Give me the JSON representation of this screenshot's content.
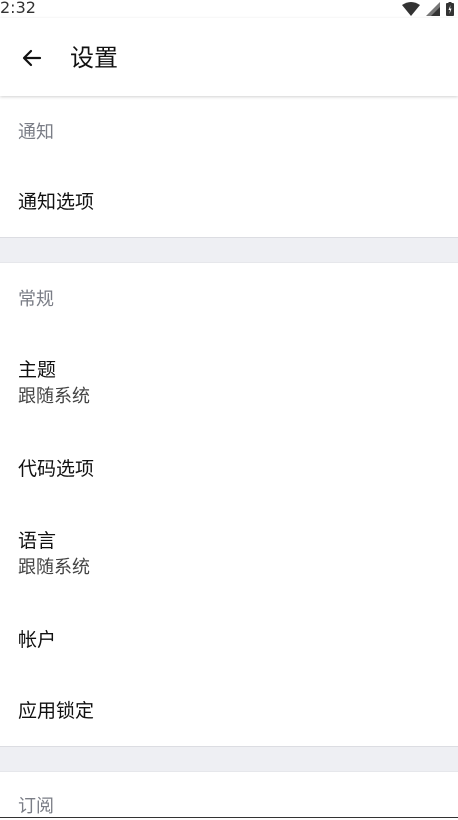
{
  "status_bar": {
    "time": "2:32",
    "icons": [
      "wifi-icon",
      "cellular-signal-icon",
      "battery-icon"
    ]
  },
  "app_bar": {
    "back_icon": "arrow-left-icon",
    "title": "设置"
  },
  "sections": {
    "notifications": {
      "header": "通知",
      "items": [
        {
          "title": "通知选项"
        }
      ]
    },
    "general": {
      "header": "常规",
      "items": [
        {
          "title": "主题",
          "subtitle": "跟随系统"
        },
        {
          "title": "代码选项"
        },
        {
          "title": "语言",
          "subtitle": "跟随系统"
        },
        {
          "title": "帐户"
        },
        {
          "title": "应用锁定"
        }
      ]
    },
    "subscription": {
      "header": "订阅"
    }
  },
  "colors": {
    "background": "#ffffff",
    "section_gap": "#eeeff3",
    "header_text": "#7a7d86",
    "primary_text": "#111111"
  }
}
